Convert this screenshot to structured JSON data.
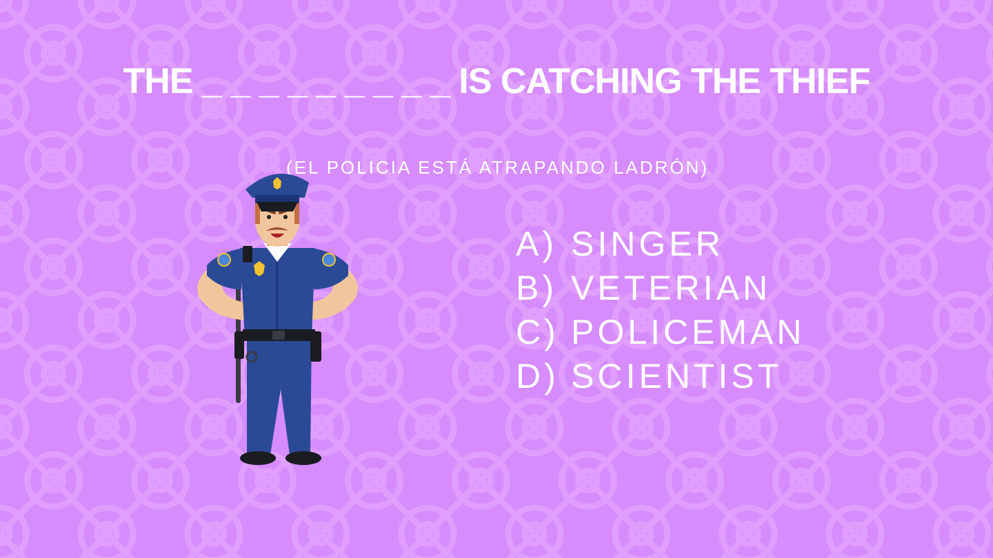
{
  "question": {
    "text": "THE _ _ _ _ _ _ _ _ _ IS CATCHING THE THIEF",
    "translation": "(EL POLICIA ESTÁ ATRAPANDO LADRÓN)"
  },
  "options": [
    {
      "letter": "A)",
      "label": "SINGER"
    },
    {
      "letter": "B)",
      "label": "VETERIAN"
    },
    {
      "letter": "C)",
      "label": "POLICEMAN"
    },
    {
      "letter": "D)",
      "label": "SCIENTIST"
    }
  ],
  "illustration": {
    "subject": "policeman-illustration"
  },
  "colors": {
    "background": "#d68cfd",
    "pattern": "#e3a6ff",
    "text": "#ffffff",
    "uniform": "#2b4a96"
  }
}
